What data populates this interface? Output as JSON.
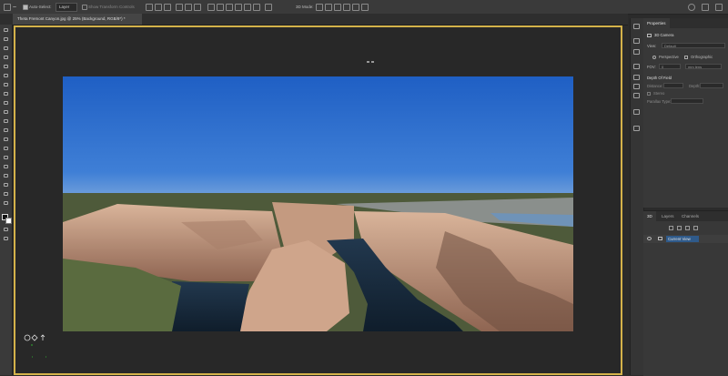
{
  "options_bar": {
    "auto_select_label": "Auto-Select:",
    "auto_select_value": "Layer",
    "show_transform_label": "Show Transform Controls",
    "mode_3d_label": "3D Mode:"
  },
  "document": {
    "tab_title": "Theta Fremont Canyon.jpg @ 25% (Background, RGB/8*) *"
  },
  "properties": {
    "panel_title": "Properties",
    "section_title": "3D Camera",
    "view_label": "View:",
    "view_value": "Default",
    "perspective_label": "Perspective",
    "orthographic_label": "Orthographic",
    "fov_label": "FOV:",
    "fov_value": "0",
    "fov_unit": "mm lens",
    "dof_title": "Depth Of Field",
    "distance_label": "Distance:",
    "depth_label": "Depth:",
    "stereo_label": "Stereo",
    "parallax_label": "Parallax Type:"
  },
  "layers_panel": {
    "tabs": [
      "3D",
      "Layers",
      "Channels"
    ],
    "selected_row_label": "Current View"
  },
  "colors": {
    "accent_border": "#d4b24a",
    "selection": "#2f5a8a"
  }
}
